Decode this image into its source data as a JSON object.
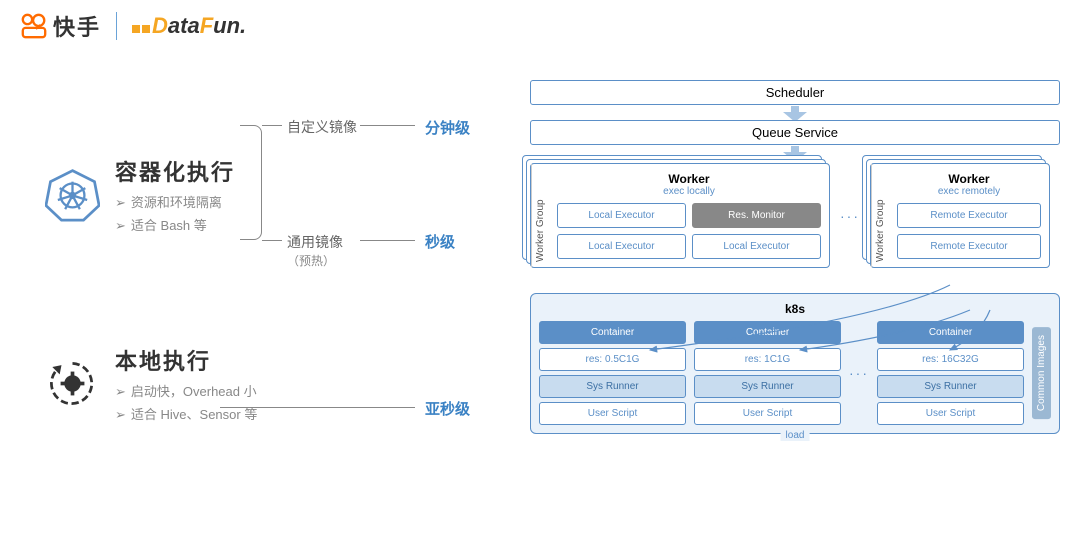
{
  "header": {
    "kuaishou": "快手",
    "datafun_prefix": "D",
    "datafun_mid": "ata",
    "datafun_f": "F",
    "datafun_suffix": "un."
  },
  "left": {
    "container": {
      "title": "容器化执行",
      "sub1": "资源和环境隔离",
      "sub2": "适合 Bash 等"
    },
    "local": {
      "title": "本地执行",
      "sub1": "启动快，Overhead 小",
      "sub2": "适合 Hive、Sensor 等"
    },
    "branch1": "自定义镜像",
    "branch2": "通用镜像",
    "branch2_sub": "（预热）",
    "level1": "分钟级",
    "level2": "秒级",
    "level3": "亚秒级"
  },
  "right": {
    "scheduler": "Scheduler",
    "queue": "Queue Service",
    "wg_label": "Worker Group",
    "worker1": {
      "title": "Worker",
      "sub": "exec locally",
      "b1": "Local Executor",
      "b2": "Res. Monitor",
      "b3": "Local Executor",
      "b4": "Local Executor"
    },
    "worker2": {
      "title": "Worker",
      "sub": "exec remotely",
      "b1": "Remote Executor",
      "b2": "Remote Executor"
    },
    "k8s": {
      "title": "k8s",
      "c1": {
        "head": "Container",
        "res": "res: 0.5C1G",
        "sys": "Sys Runner",
        "usr": "User Script"
      },
      "c2": {
        "head": "Container",
        "res": "res: 1C1G",
        "sys": "Sys Runner",
        "usr": "User Script"
      },
      "c3": {
        "head": "Container",
        "res": "res: 16C32G",
        "sys": "Sys Runner",
        "usr": "User Script"
      },
      "common": "Common Images",
      "load": "load"
    },
    "dots": "···"
  }
}
